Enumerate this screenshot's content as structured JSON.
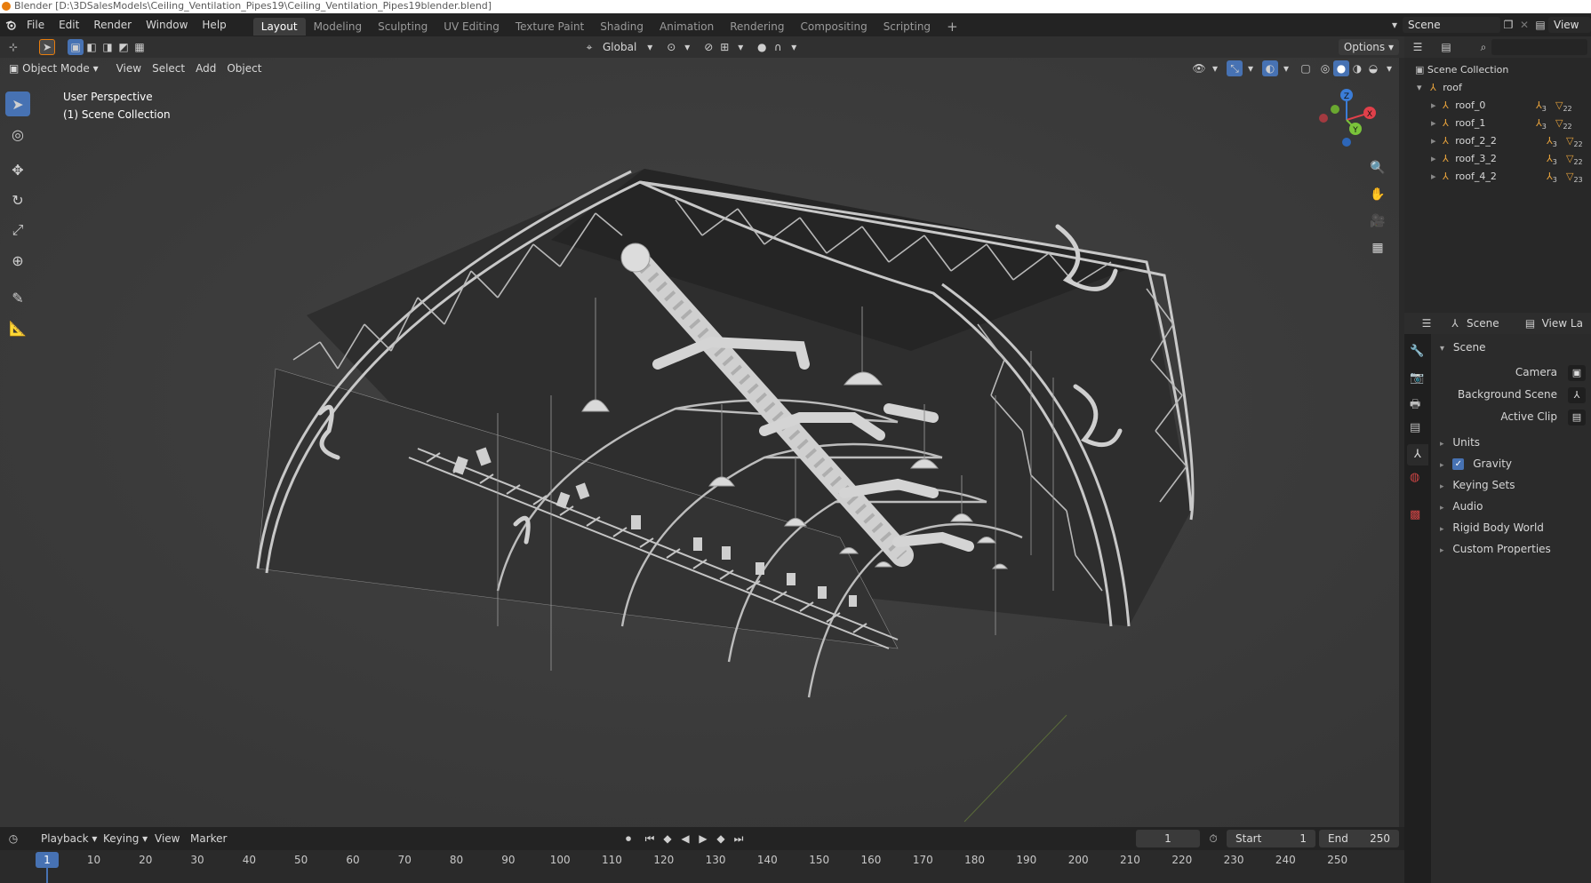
{
  "window": {
    "title": "Blender [D:\\3DSalesModels\\Ceiling_Ventilation_Pipes19\\Ceiling_Ventilation_Pipes19blender.blend]"
  },
  "menu": [
    "File",
    "Edit",
    "Render",
    "Window",
    "Help"
  ],
  "workspaces": [
    "Layout",
    "Modeling",
    "Sculpting",
    "UV Editing",
    "Texture Paint",
    "Shading",
    "Animation",
    "Rendering",
    "Compositing",
    "Scripting"
  ],
  "active_workspace": "Layout",
  "scene_name": "Scene",
  "view_layer": "View La",
  "header": {
    "orientation": "Global",
    "options": "Options"
  },
  "viewport_header": {
    "mode": "Object Mode",
    "menus": [
      "View",
      "Select",
      "Add",
      "Object"
    ]
  },
  "viewport_overlay": {
    "perspective": "User Perspective",
    "collection": "(1) Scene Collection"
  },
  "gizmo": {
    "x": "X",
    "y": "Y",
    "z": "Z"
  },
  "outliner": {
    "root": "Scene Collection",
    "collection": "roof",
    "objects": [
      {
        "name": "roof_0",
        "badge1": "3",
        "badge2": "22"
      },
      {
        "name": "roof_1",
        "badge1": "3",
        "badge2": "22"
      },
      {
        "name": "roof_2_2",
        "badge1": "3",
        "badge2": "22"
      },
      {
        "name": "roof_3_2",
        "badge1": "3",
        "badge2": "22"
      },
      {
        "name": "roof_4_2",
        "badge1": "3",
        "badge2": "23"
      }
    ]
  },
  "properties": {
    "tab_scene": "Scene",
    "tab_view_layer": "View La",
    "panel_title": "Scene",
    "camera_label": "Camera",
    "background_label": "Background Scene",
    "clip_label": "Active Clip",
    "sections": [
      "Units",
      "Gravity",
      "Keying Sets",
      "Audio",
      "Rigid Body World",
      "Custom Properties"
    ],
    "gravity_checked": true
  },
  "timeline": {
    "menus": [
      "Playback",
      "Keying",
      "View",
      "Marker"
    ],
    "current_frame": "1",
    "start_label": "Start",
    "start": "1",
    "end_label": "End",
    "end": "250",
    "ticks": [
      "1",
      "10",
      "20",
      "30",
      "40",
      "50",
      "60",
      "70",
      "80",
      "90",
      "100",
      "110",
      "120",
      "130",
      "140",
      "150",
      "160",
      "170",
      "180",
      "190",
      "200",
      "210",
      "220",
      "230",
      "240",
      "250"
    ]
  }
}
